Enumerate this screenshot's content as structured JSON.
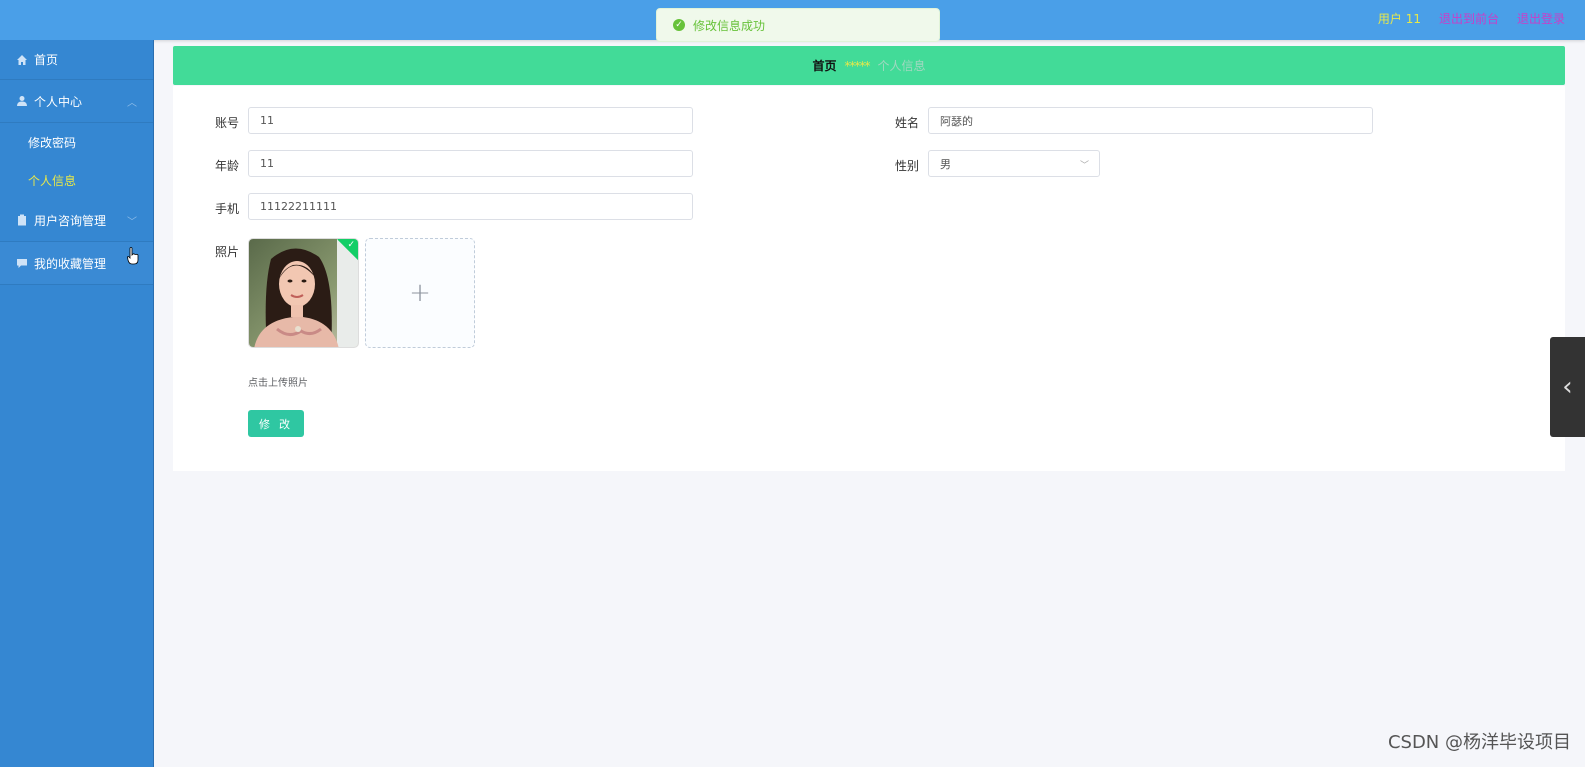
{
  "topbar": {
    "user_label": "用户 11",
    "link_front": "退出到前台",
    "link_logout": "退出登录"
  },
  "toast": {
    "icon": "check-circle-icon",
    "message": "修改信息成功"
  },
  "sidebar": {
    "items": [
      {
        "label": "首页",
        "icon": "home-icon"
      },
      {
        "label": "个人中心",
        "icon": "user-icon",
        "expanded": true,
        "children": [
          {
            "label": "修改密码"
          },
          {
            "label": "个人信息",
            "active": true
          }
        ]
      },
      {
        "label": "用户咨询管理",
        "icon": "clipboard-icon",
        "expanded": false
      },
      {
        "label": "我的收藏管理",
        "icon": "chat-icon"
      }
    ]
  },
  "breadcrumb": {
    "home": "首页",
    "separator": "*****",
    "current": "个人信息"
  },
  "form": {
    "account_label": "账号",
    "account_value": "11",
    "name_label": "姓名",
    "name_value": "阿瑟的",
    "age_label": "年龄",
    "age_value": "11",
    "gender_label": "性别",
    "gender_value": "男",
    "phone_label": "手机",
    "phone_value": "11122211111",
    "photo_label": "照片",
    "upload_tip": "点击上传照片",
    "submit_label": "修 改"
  },
  "watermark": "CSDN @杨洋毕设项目",
  "colors": {
    "topbar": "#4a9fe8",
    "sidebar": "#3587d2",
    "breadcrumb_bar": "#42db98",
    "active_menu": "#e8e84a",
    "submit_button": "#2fc7a2",
    "toast_success": "#67c23a"
  }
}
